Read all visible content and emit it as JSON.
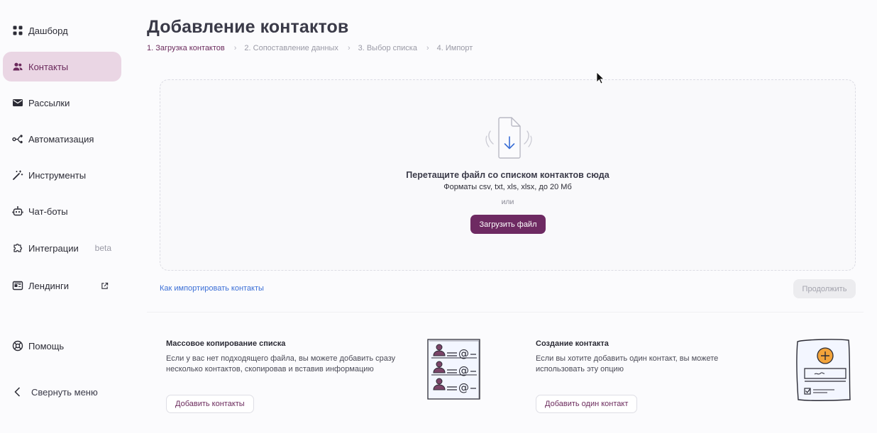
{
  "sidebar": {
    "items": [
      {
        "label": "Дашборд",
        "icon": "dashboard-icon"
      },
      {
        "label": "Контакты",
        "icon": "contacts-icon",
        "active": true
      },
      {
        "label": "Рассылки",
        "icon": "mail-icon"
      },
      {
        "label": "Автоматизация",
        "icon": "automation-icon"
      },
      {
        "label": "Инструменты",
        "icon": "magic-wand-icon"
      },
      {
        "label": "Чат-боты",
        "icon": "bot-icon"
      },
      {
        "label": "Интеграции",
        "icon": "puzzle-icon",
        "badge": "beta"
      },
      {
        "label": "Лендинги",
        "icon": "landing-icon",
        "external": true
      },
      {
        "label": "Помощь",
        "icon": "help-icon"
      }
    ],
    "collapse_label": "Свернуть меню"
  },
  "page": {
    "title": "Добавление контактов",
    "steps": [
      {
        "label": "1. Загрузка контактов",
        "active": true
      },
      {
        "label": "2. Сопоставление данных"
      },
      {
        "label": "3. Выбор списка"
      },
      {
        "label": "4. Импорт"
      }
    ]
  },
  "dropzone": {
    "title": "Перетащите файл со списком контактов сюда",
    "formats": "Форматы csv, txt, xls, xlsx, до 20 Мб",
    "or": "или",
    "upload_label": "Загрузить файл"
  },
  "help_link": "Как импортировать контакты",
  "continue_label": "Продолжить",
  "cards": [
    {
      "title": "Массовое копирование списка",
      "description_lines": [
        "Если у вас нет подходящего файла, вы можете добавить сразу",
        "несколько контактов, скопировав и вставив информацию"
      ],
      "button_label": "Добавить контакты"
    },
    {
      "title": "Создание контакта",
      "description_lines": [
        "Если вы хотите добавить один контакт, вы можете",
        "использовать эту опцию"
      ],
      "button_label": "Добавить один контакт"
    }
  ],
  "colors": {
    "accent": "#6e2a62",
    "active_bg": "#ead6e4",
    "link": "#3b6fd6",
    "illustration_orange": "#f2a33a"
  }
}
